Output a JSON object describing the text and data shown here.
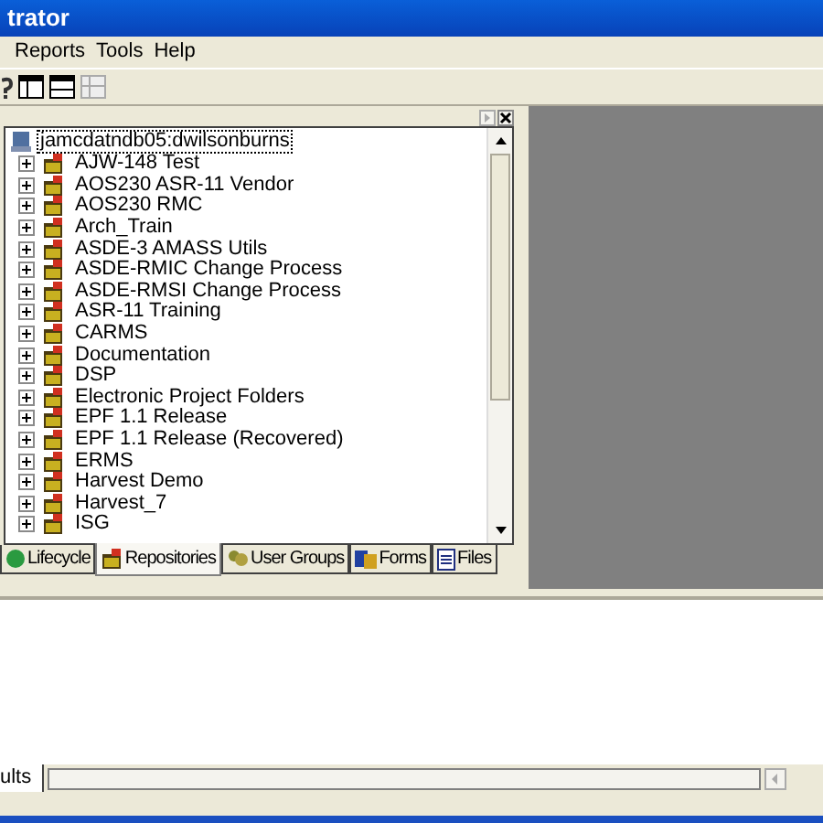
{
  "window": {
    "title": "trator"
  },
  "menu": [
    "Reports",
    "Tools",
    "Help"
  ],
  "tree": {
    "root": "jamcdatndb05:dwilsonburns",
    "items": [
      {
        "label": "AJW-148 Test",
        "expanded": false
      },
      {
        "label": "AOS230 ASR-11 Vendor",
        "expanded": false
      },
      {
        "label": "AOS230 RMC",
        "expanded": false
      },
      {
        "label": "Arch_Train",
        "expanded": false
      },
      {
        "label": "ASDE-3 AMASS Utils",
        "expanded": false
      },
      {
        "label": "ASDE-RMIC Change Process",
        "expanded": false
      },
      {
        "label": "ASDE-RMSI Change Process",
        "expanded": false
      },
      {
        "label": "ASR-11 Training",
        "expanded": false
      },
      {
        "label": "CARMS",
        "expanded": false
      },
      {
        "label": "Documentation",
        "expanded": false
      },
      {
        "label": "DSP",
        "expanded": false
      },
      {
        "label": "Electronic Project Folders",
        "expanded": false
      },
      {
        "label": "EPF 1.1 Release",
        "expanded": false
      },
      {
        "label": "EPF 1.1 Release (Recovered)",
        "expanded": false
      },
      {
        "label": "ERMS",
        "expanded": false
      },
      {
        "label": "Harvest Demo",
        "expanded": false
      },
      {
        "label": "Harvest_7",
        "expanded": false
      },
      {
        "label": "ISG",
        "expanded": false
      }
    ]
  },
  "tabs": [
    {
      "label": "Lifecycle",
      "selected": false,
      "kind": "lifecycle"
    },
    {
      "label": "Repositories",
      "selected": true,
      "kind": "repo"
    },
    {
      "label": "User Groups",
      "selected": false,
      "kind": "users"
    },
    {
      "label": "Forms",
      "selected": false,
      "kind": "forms"
    },
    {
      "label": "Files",
      "selected": false,
      "kind": "files"
    }
  ],
  "output_tabs": [
    {
      "label": "ults",
      "selected": true
    }
  ]
}
